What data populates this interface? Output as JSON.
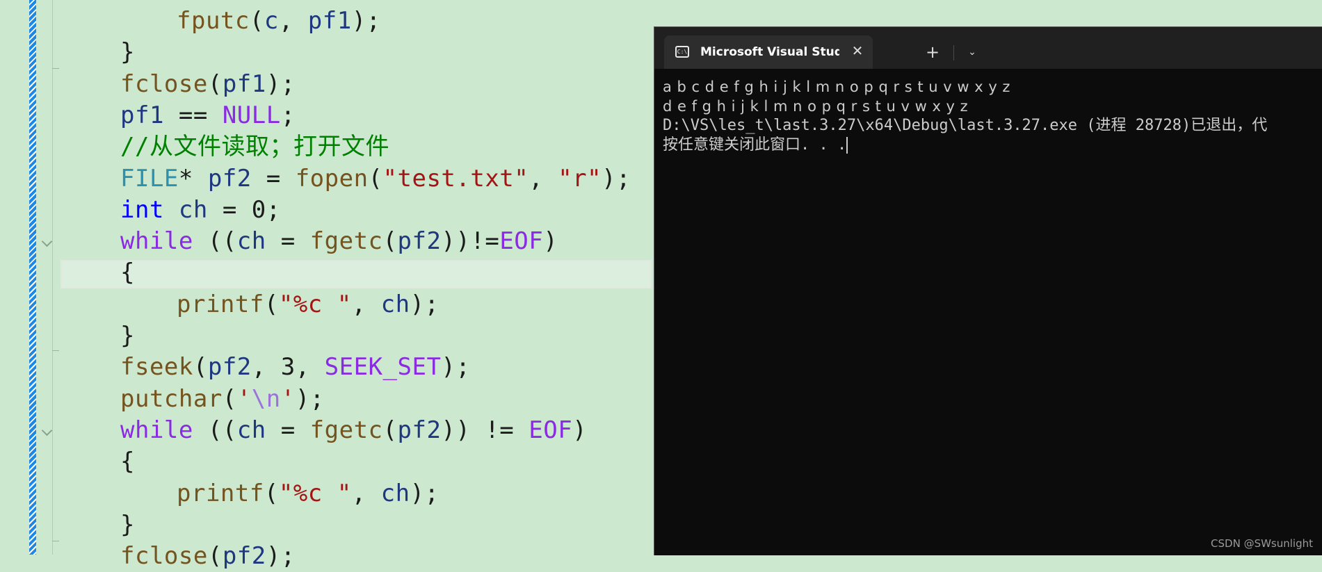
{
  "editor": {
    "lines": [
      {
        "indent": 2,
        "tokens": [
          {
            "t": "fputc",
            "c": "fn"
          },
          {
            "t": "(",
            "c": ""
          },
          {
            "t": "c",
            "c": "var"
          },
          {
            "t": ", ",
            "c": ""
          },
          {
            "t": "pf1",
            "c": "var"
          },
          {
            "t": ");",
            "c": ""
          }
        ]
      },
      {
        "indent": 1,
        "tokens": [
          {
            "t": "}",
            "c": ""
          }
        ]
      },
      {
        "indent": 1,
        "tokens": [
          {
            "t": "fclose",
            "c": "fn"
          },
          {
            "t": "(",
            "c": ""
          },
          {
            "t": "pf1",
            "c": "var"
          },
          {
            "t": ");",
            "c": ""
          }
        ]
      },
      {
        "indent": 1,
        "tokens": [
          {
            "t": "pf1",
            "c": "var"
          },
          {
            "t": " == ",
            "c": ""
          },
          {
            "t": "NULL",
            "c": "macro"
          },
          {
            "t": ";",
            "c": ""
          }
        ]
      },
      {
        "indent": 1,
        "tokens": [
          {
            "t": "//从文件读取；打开文件",
            "c": "com"
          }
        ]
      },
      {
        "indent": 1,
        "tokens": [
          {
            "t": "FILE",
            "c": "type"
          },
          {
            "t": "* ",
            "c": ""
          },
          {
            "t": "pf2",
            "c": "var"
          },
          {
            "t": " = ",
            "c": ""
          },
          {
            "t": "fopen",
            "c": "fn"
          },
          {
            "t": "(",
            "c": ""
          },
          {
            "t": "\"test.txt\"",
            "c": "str"
          },
          {
            "t": ", ",
            "c": ""
          },
          {
            "t": "\"r\"",
            "c": "str"
          },
          {
            "t": ");",
            "c": ""
          }
        ]
      },
      {
        "indent": 1,
        "tokens": [
          {
            "t": "int",
            "c": "kw"
          },
          {
            "t": " ",
            "c": ""
          },
          {
            "t": "ch",
            "c": "var"
          },
          {
            "t": " = ",
            "c": ""
          },
          {
            "t": "0",
            "c": "num"
          },
          {
            "t": ";",
            "c": ""
          }
        ]
      },
      {
        "indent": 1,
        "tokens": [
          {
            "t": "while",
            "c": "macro"
          },
          {
            "t": " ((",
            "c": ""
          },
          {
            "t": "ch",
            "c": "var"
          },
          {
            "t": " = ",
            "c": ""
          },
          {
            "t": "fgetc",
            "c": "fn"
          },
          {
            "t": "(",
            "c": ""
          },
          {
            "t": "pf2",
            "c": "var"
          },
          {
            "t": "))!=",
            "c": ""
          },
          {
            "t": "EOF",
            "c": "macro"
          },
          {
            "t": ")",
            "c": ""
          }
        ]
      },
      {
        "indent": 1,
        "tokens": [
          {
            "t": "{",
            "c": ""
          }
        ]
      },
      {
        "indent": 2,
        "tokens": [
          {
            "t": "printf",
            "c": "fn"
          },
          {
            "t": "(",
            "c": ""
          },
          {
            "t": "\"%c \"",
            "c": "str"
          },
          {
            "t": ", ",
            "c": ""
          },
          {
            "t": "ch",
            "c": "var"
          },
          {
            "t": ");",
            "c": ""
          }
        ]
      },
      {
        "indent": 1,
        "tokens": [
          {
            "t": "}",
            "c": ""
          }
        ]
      },
      {
        "indent": 1,
        "tokens": [
          {
            "t": "fseek",
            "c": "fn"
          },
          {
            "t": "(",
            "c": ""
          },
          {
            "t": "pf2",
            "c": "var"
          },
          {
            "t": ", ",
            "c": ""
          },
          {
            "t": "3",
            "c": "num"
          },
          {
            "t": ", ",
            "c": ""
          },
          {
            "t": "SEEK_SET",
            "c": "macro"
          },
          {
            "t": ");",
            "c": ""
          }
        ]
      },
      {
        "indent": 1,
        "tokens": [
          {
            "t": "putchar",
            "c": "fn"
          },
          {
            "t": "(",
            "c": ""
          },
          {
            "t": "'",
            "c": "str"
          },
          {
            "t": "\\n",
            "c": "esc"
          },
          {
            "t": "'",
            "c": "str"
          },
          {
            "t": ");",
            "c": ""
          }
        ]
      },
      {
        "indent": 1,
        "tokens": [
          {
            "t": "while",
            "c": "macro"
          },
          {
            "t": " ((",
            "c": ""
          },
          {
            "t": "ch",
            "c": "var"
          },
          {
            "t": " = ",
            "c": ""
          },
          {
            "t": "fgetc",
            "c": "fn"
          },
          {
            "t": "(",
            "c": ""
          },
          {
            "t": "pf2",
            "c": "var"
          },
          {
            "t": ")) != ",
            "c": ""
          },
          {
            "t": "EOF",
            "c": "macro"
          },
          {
            "t": ")",
            "c": ""
          }
        ]
      },
      {
        "indent": 1,
        "tokens": [
          {
            "t": "{",
            "c": ""
          }
        ]
      },
      {
        "indent": 2,
        "tokens": [
          {
            "t": "printf",
            "c": "fn"
          },
          {
            "t": "(",
            "c": ""
          },
          {
            "t": "\"%c \"",
            "c": "str"
          },
          {
            "t": ", ",
            "c": ""
          },
          {
            "t": "ch",
            "c": "var"
          },
          {
            "t": ");",
            "c": ""
          }
        ]
      },
      {
        "indent": 1,
        "tokens": [
          {
            "t": "}",
            "c": ""
          }
        ]
      },
      {
        "indent": 1,
        "tokens": [
          {
            "t": "fclose",
            "c": "fn"
          },
          {
            "t": "(",
            "c": ""
          },
          {
            "t": "pf2",
            "c": "var"
          },
          {
            "t": ");",
            "c": ""
          }
        ]
      }
    ]
  },
  "terminal": {
    "tab_title": "Microsoft Visual Studio 调试控制台",
    "tab_icon": "terminal-icon",
    "close_symbol": "✕",
    "new_tab_symbol": "+",
    "dropdown_symbol": "⌄",
    "output": {
      "line1": "a b c d e f g h i j k l m n o p q r s t u v w x y z",
      "line2": "d e f g h i j k l m n o p q r s t u v w x y z",
      "line3": "D:\\VS\\les_t\\last.3.27\\x64\\Debug\\last.3.27.exe (进程 28728)已退出，代",
      "line4": "按任意键关闭此窗口. . ."
    }
  },
  "watermark": "CSDN @SWsunlight",
  "colors": {
    "editor_bg": "#cce8cf",
    "terminal_bg": "#0c0c0c",
    "change_bar": "#1e88e5"
  }
}
